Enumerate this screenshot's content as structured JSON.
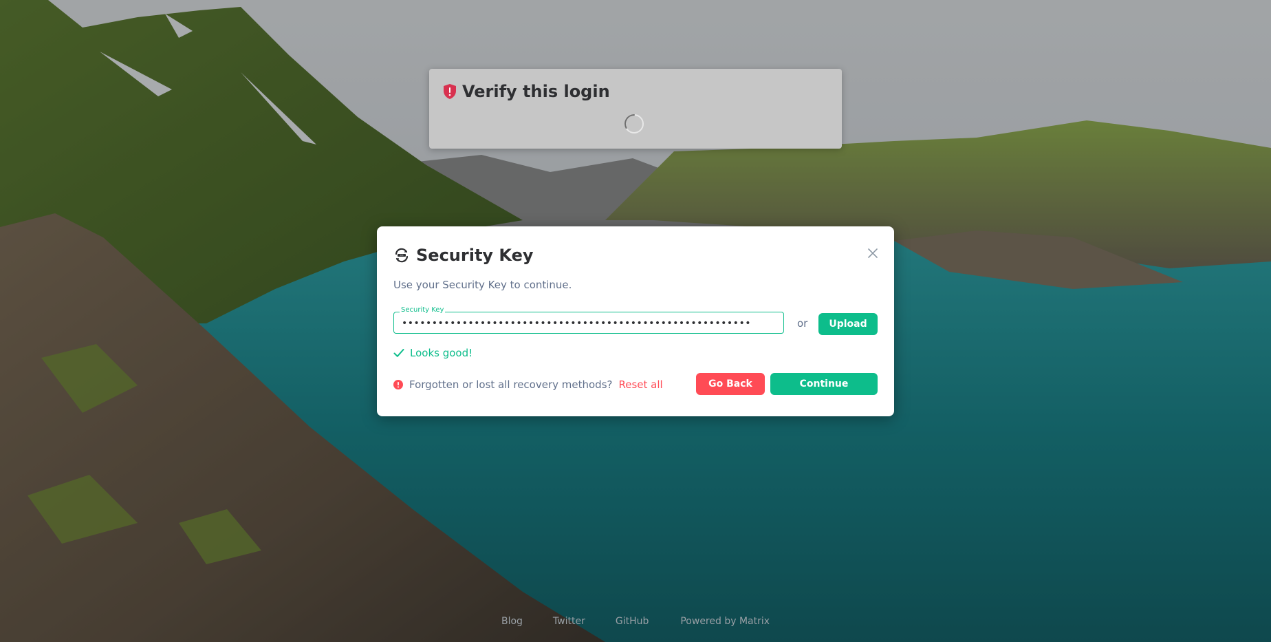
{
  "verify": {
    "title": "Verify this login"
  },
  "dialog": {
    "title": "Security Key",
    "description": "Use your Security Key to continue.",
    "key_field": {
      "label": "Security Key",
      "value": "••••••••••••••••••••••••••••••••••••••••••••••••••••••••••"
    },
    "or_text": "or",
    "upload_label": "Upload",
    "validation": "Looks good!",
    "forgot_text": "Forgotten or lost all recovery methods?",
    "reset_link": "Reset all",
    "goback_label": "Go Back",
    "continue_label": "Continue"
  },
  "footer": {
    "links": [
      "Blog",
      "Twitter",
      "GitHub",
      "Powered by Matrix"
    ]
  },
  "colors": {
    "accent": "#0dbd8b",
    "alert": "#ff4b55",
    "shield": "#d8314f"
  }
}
